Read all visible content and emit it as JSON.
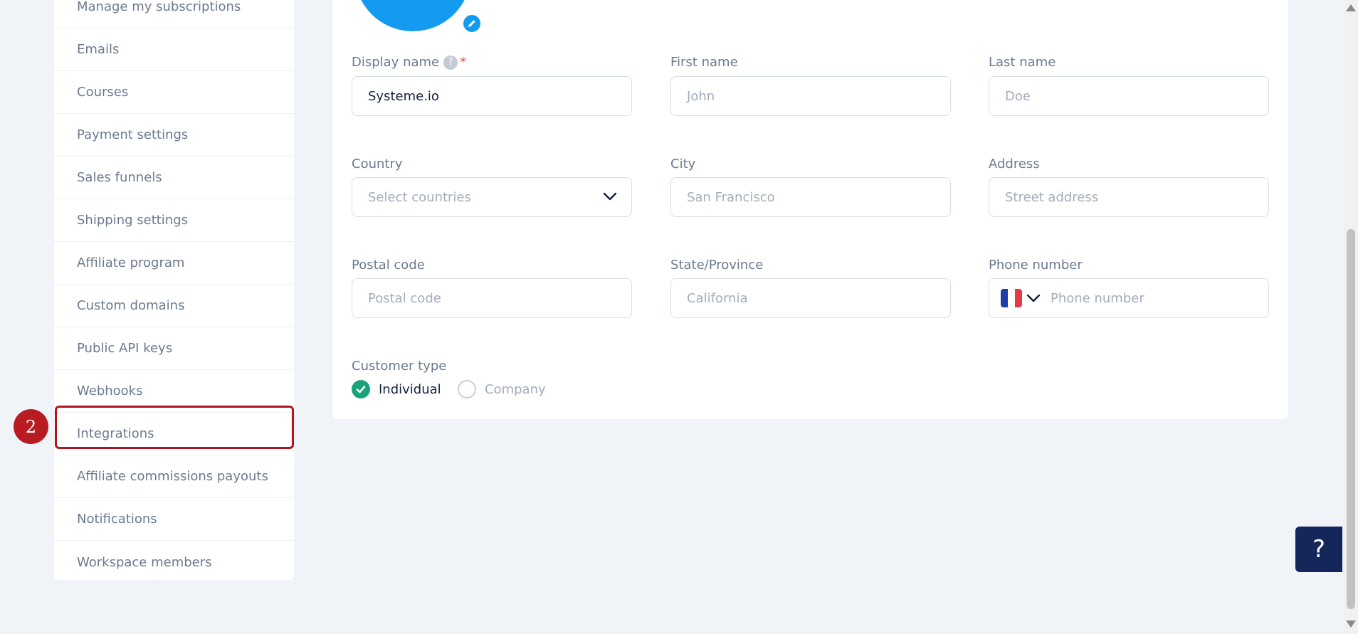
{
  "sidebar": {
    "items": [
      {
        "label": "Manage my subscriptions"
      },
      {
        "label": "Emails"
      },
      {
        "label": "Courses"
      },
      {
        "label": "Payment settings"
      },
      {
        "label": "Sales funnels"
      },
      {
        "label": "Shipping settings"
      },
      {
        "label": "Affiliate program"
      },
      {
        "label": "Custom domains"
      },
      {
        "label": "Public API keys"
      },
      {
        "label": "Webhooks"
      },
      {
        "label": "Integrations"
      },
      {
        "label": "Affiliate commissions payouts"
      },
      {
        "label": "Notifications"
      },
      {
        "label": "Workspace members"
      }
    ],
    "highlight_step": "2"
  },
  "form": {
    "display_name": {
      "label": "Display name",
      "help": "?",
      "required_mark": "*",
      "value": "Systeme.io"
    },
    "first_name": {
      "label": "First name",
      "placeholder": "John"
    },
    "last_name": {
      "label": "Last name",
      "placeholder": "Doe"
    },
    "country": {
      "label": "Country",
      "placeholder": "Select countries"
    },
    "city": {
      "label": "City",
      "placeholder": "San Francisco"
    },
    "address": {
      "label": "Address",
      "placeholder": "Street address"
    },
    "postal_code": {
      "label": "Postal code",
      "placeholder": "Postal code"
    },
    "state": {
      "label": "State/Province",
      "placeholder": "California"
    },
    "phone": {
      "label": "Phone number",
      "placeholder": "Phone number",
      "flag_icon": "france-flag-icon"
    },
    "customer_type": {
      "label": "Customer type",
      "options": [
        {
          "label": "Individual",
          "selected": true
        },
        {
          "label": "Company",
          "selected": false
        }
      ]
    }
  },
  "help_button": {
    "label": "?"
  },
  "colors": {
    "accent": "#139bf2",
    "highlight": "#b0151d",
    "check": "#1aa37a",
    "help_bg": "#14265a"
  }
}
